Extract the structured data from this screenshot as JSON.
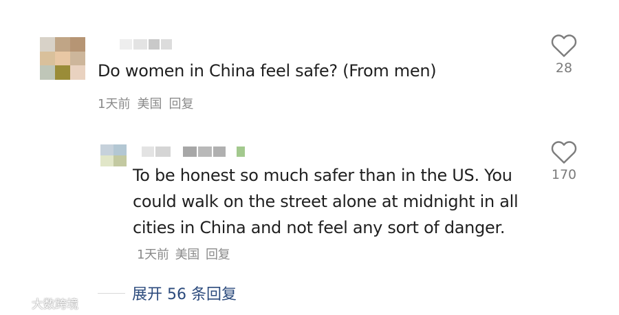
{
  "comments": [
    {
      "text": "Do women in China feel safe? (From men)",
      "time": "1天前",
      "location": "美国",
      "reply_label": "回复",
      "likes": "28",
      "avatar_colors": [
        "#d8d2c8",
        "#c0a586",
        "#b69574",
        "#d9c09b",
        "#e8c7a4",
        "#cdb69b",
        "#bfc6b8",
        "#9a8c38",
        "#e9d2c0"
      ],
      "username_colors": [
        "#eeeeee",
        "#e3e3e3",
        "#c9c9c9",
        "#dcdcdc"
      ]
    },
    {
      "text": "To be honest so much safer than in the US. You could walk on the street alone at midnight in all cities in China and not feel any sort of danger.",
      "time": "1天前",
      "location": "美国",
      "reply_label": "回复",
      "likes": "170",
      "avatar_colors": [
        "#c6d1db",
        "#b3c7d3",
        "#e1e6c8",
        "#c3c9a1"
      ],
      "username_colors": [
        "#e3e3e3",
        "#d5d5d5",
        "#a7a7a7",
        "#b9b9b9",
        "#b0b0b0",
        "#a3c98e"
      ]
    }
  ],
  "expand_replies": "展开 56 条回复",
  "watermark": "大数跨境",
  "icons": {
    "like": "heart-outline-icon",
    "watermark": "chat-bubbles-icon"
  }
}
